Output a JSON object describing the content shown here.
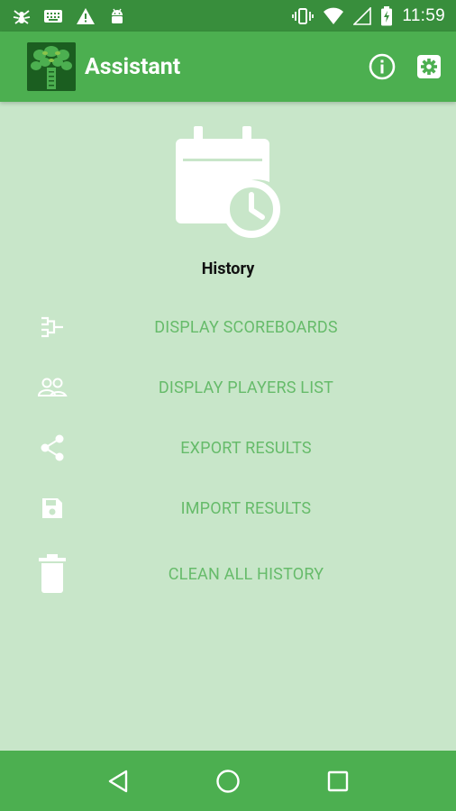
{
  "status_bar": {
    "time": "11:59",
    "icons_left": [
      "spider-icon",
      "keyboard-icon",
      "warning-icon",
      "android-icon"
    ],
    "icons_right": [
      "vibrate-icon",
      "wifi-icon",
      "signal-icon",
      "battery-charging-icon"
    ]
  },
  "app_bar": {
    "title": "Assistant",
    "actions": [
      "info-icon",
      "settings-icon"
    ]
  },
  "hero": {
    "icon": "calendar-clock-icon",
    "label": "History"
  },
  "menu": {
    "items": [
      {
        "label": "DISPLAY SCOREBOARDS",
        "icon": "bracket-icon"
      },
      {
        "label": "DISPLAY PLAYERS LIST",
        "icon": "people-icon"
      },
      {
        "label": "EXPORT RESULTS",
        "icon": "share-icon"
      },
      {
        "label": "IMPORT RESULTS",
        "icon": "save-icon"
      },
      {
        "label": "CLEAN ALL HISTORY",
        "icon": "trash-icon"
      }
    ]
  },
  "nav_bar": {
    "buttons": [
      "back-icon",
      "home-icon",
      "recents-icon"
    ]
  },
  "colors": {
    "status_bar": "#388e3c",
    "app_bar": "#4caf50",
    "background": "#c8e6c9",
    "menu_text": "#66bb6a",
    "icon_white": "#ffffff"
  }
}
